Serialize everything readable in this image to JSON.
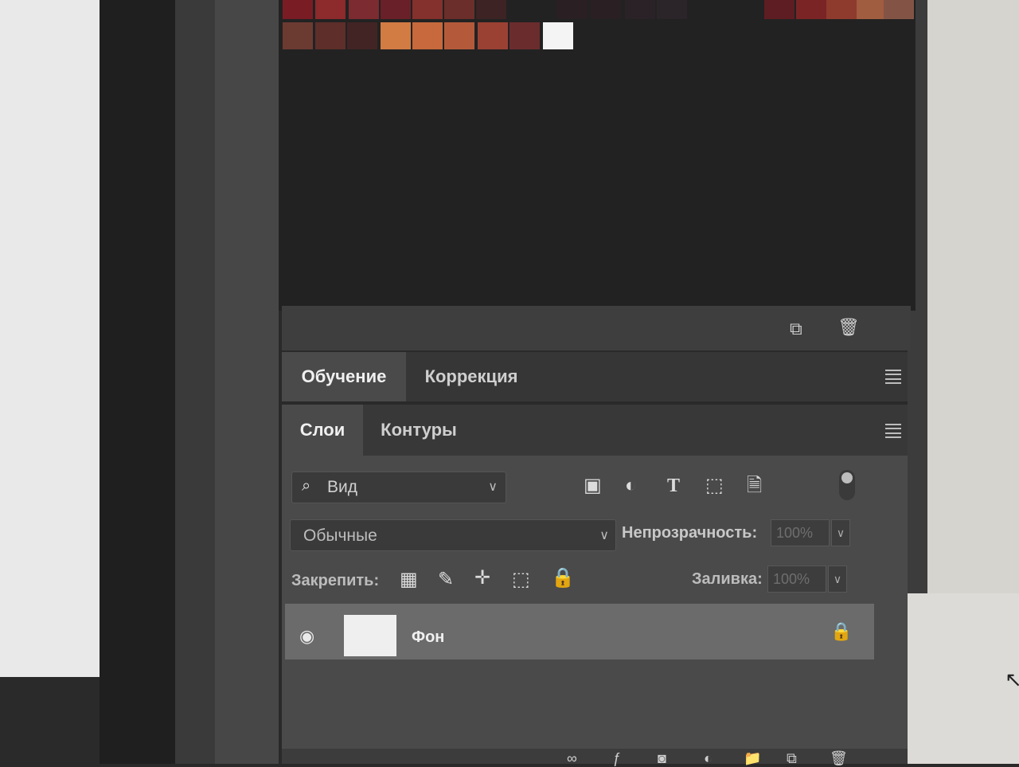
{
  "swatches": {
    "row1_colors": [
      "#7a1c24",
      "#8c2a2c",
      "#7c2b30",
      "#6a2028",
      "#84302c",
      "#6b2e2a",
      "#3d2323",
      "#2a1f22",
      "#2a1f22",
      "#2a2227",
      "#2b252a",
      "#5e1d22",
      "#7b2426",
      "#8e3b2e",
      "#a05d3f",
      "#835445"
    ],
    "row2_colors": [
      "#6b3b32",
      "#5e2e2a",
      "#422424",
      "#d27c44",
      "#c7693c",
      "#b45a3a",
      "#9a4133",
      "#6b2c2e",
      "#f4f4f4"
    ],
    "footer_icons": [
      "new-swatch-icon",
      "trash-icon"
    ]
  },
  "panels": {
    "tabs_top": [
      {
        "label": "Обучение",
        "active": true
      },
      {
        "label": "Коррекция",
        "active": false
      }
    ],
    "tabs_layers": [
      {
        "label": "Слои",
        "active": true
      },
      {
        "label": "Контуры",
        "active": false
      }
    ]
  },
  "layers": {
    "filter_label": "Вид",
    "filter_icons": [
      "image-filter-icon",
      "adjustment-filter-icon",
      "type-filter-icon",
      "shape-filter-icon",
      "smart-object-filter-icon"
    ],
    "blend_mode": "Обычные",
    "opacity_label": "Непрозрачность:",
    "opacity_value": "100%",
    "lock_label": "Закрепить:",
    "lock_icons": [
      "lock-transparency-icon",
      "lock-pixels-icon",
      "lock-position-icon",
      "lock-artboard-icon",
      "lock-all-icon"
    ],
    "fill_label": "Заливка:",
    "fill_value": "100%",
    "items": [
      {
        "name": "Фон",
        "visible": true,
        "locked": true
      }
    ]
  }
}
